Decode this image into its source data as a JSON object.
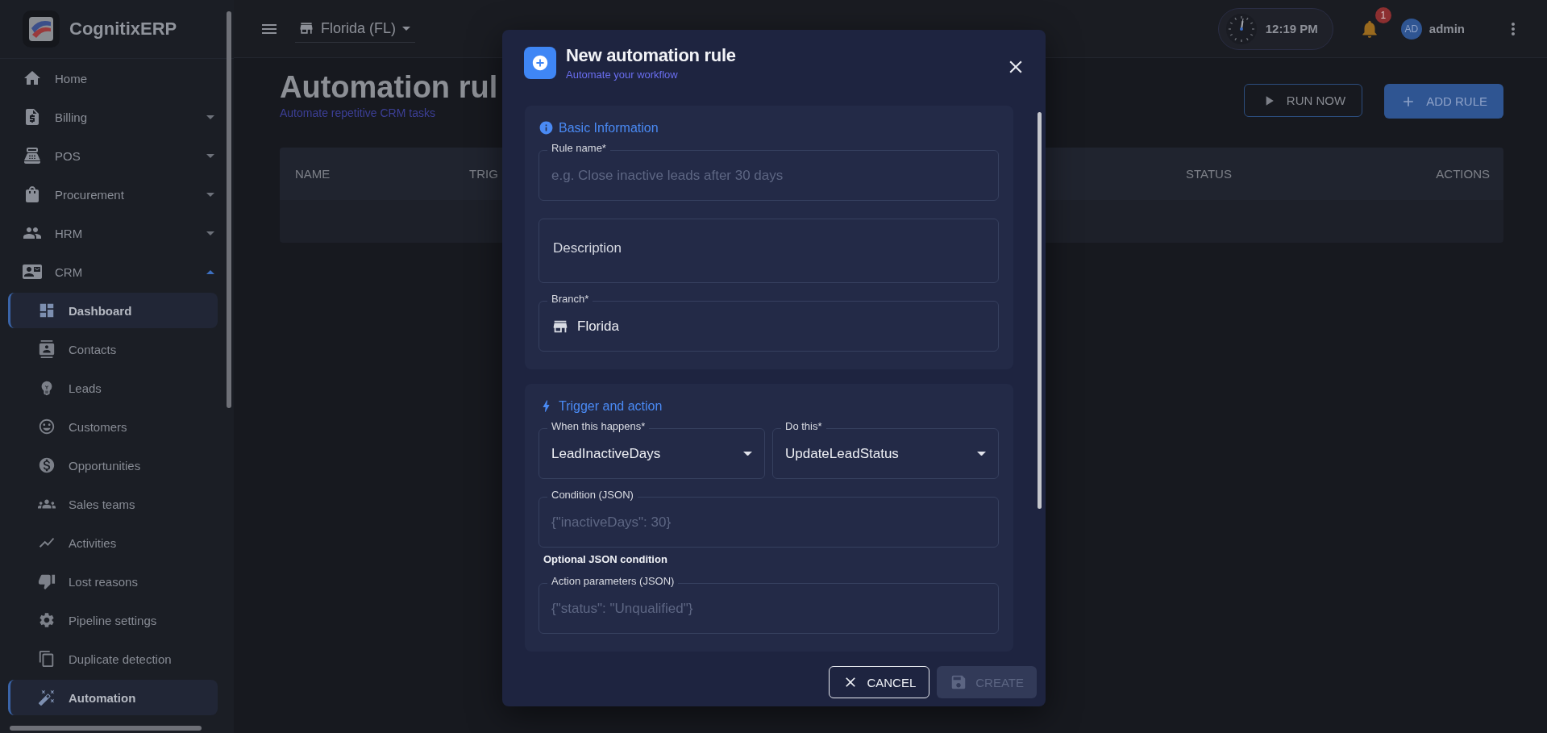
{
  "sidebar": {
    "brand": "CognitixERP",
    "items": [
      {
        "label": "Home"
      },
      {
        "label": "Billing",
        "expanded": false
      },
      {
        "label": "POS",
        "expanded": false
      },
      {
        "label": "Procurement",
        "expanded": false
      },
      {
        "label": "HRM",
        "expanded": false
      },
      {
        "label": "CRM",
        "expanded": true,
        "children": [
          {
            "label": "Dashboard",
            "selected": true
          },
          {
            "label": "Contacts",
            "selected": false
          },
          {
            "label": "Leads",
            "selected": false
          },
          {
            "label": "Customers",
            "selected": false
          },
          {
            "label": "Opportunities",
            "selected": false
          },
          {
            "label": "Sales teams",
            "selected": false
          },
          {
            "label": "Activities",
            "selected": false
          },
          {
            "label": "Lost reasons",
            "selected": false
          },
          {
            "label": "Pipeline settings",
            "selected": false
          },
          {
            "label": "Duplicate detection",
            "selected": false
          },
          {
            "label": "Automation",
            "selected": true
          }
        ]
      }
    ]
  },
  "topbar": {
    "branch": "Florida (FL)",
    "time": "12:19 PM",
    "notifications": "1",
    "avatar": "AD",
    "user": "admin"
  },
  "page": {
    "title": "Automation rul",
    "subtitle": "Automate repetitive CRM tasks",
    "buttons": [
      {
        "label": "RUN NOW",
        "kind": "outlined"
      },
      {
        "label": "ADD RULE",
        "kind": "contained"
      }
    ]
  },
  "table": {
    "columns": [
      "NAME",
      "TRIG",
      "STATUS",
      "ACTIONS"
    ]
  },
  "dialog": {
    "title": "New automation rule",
    "subtitle": "Automate your workflow",
    "sections": [
      {
        "heading": "Basic Information",
        "kind": "info",
        "fields": [
          {
            "kind": "text",
            "label": "Rule name*",
            "placeholder": "e.g. Close inactive leads after 30 days"
          },
          {
            "kind": "textarea",
            "placeholder": "Description"
          },
          {
            "kind": "branch",
            "label": "Branch*",
            "value": "Florida"
          }
        ]
      },
      {
        "heading": "Trigger and action",
        "kind": "bolt",
        "fields": [
          {
            "kind": "selects",
            "items": [
              {
                "label": "When this happens*",
                "value": "LeadInactiveDays"
              },
              {
                "label": "Do this*",
                "value": "UpdateLeadStatus"
              }
            ]
          },
          {
            "kind": "text",
            "label": "Condition (JSON)",
            "placeholder": "{\"inactiveDays\": 30}",
            "helper": "Optional JSON condition"
          },
          {
            "kind": "text",
            "label": "Action parameters (JSON)",
            "placeholder": "{\"status\": \"Unqualified\"}"
          }
        ]
      }
    ],
    "buttons": [
      {
        "label": "CANCEL",
        "kind": "cancel",
        "disabled": false
      },
      {
        "label": "CREATE",
        "kind": "save",
        "disabled": true
      }
    ]
  }
}
